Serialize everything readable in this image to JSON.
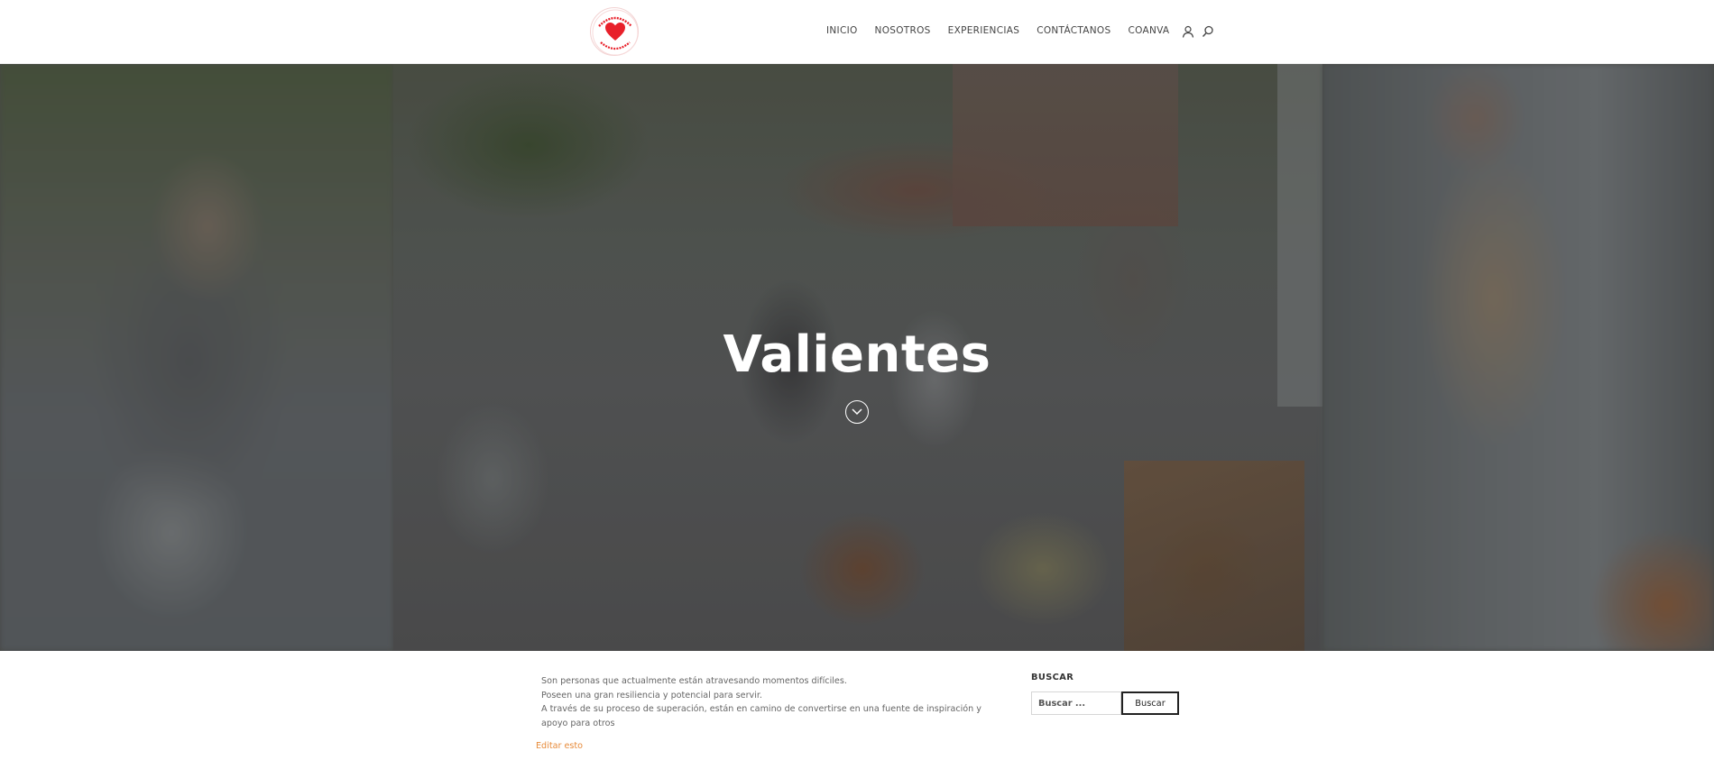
{
  "site": {
    "logo_alt": "Amanecer y Valientes Corporación"
  },
  "nav": {
    "items": [
      "INICIO",
      "NOSOTROS",
      "EXPERIENCIAS",
      "CONTÁCTANOS",
      "COANVA"
    ],
    "icons": [
      "user-icon",
      "search-icon"
    ]
  },
  "hero": {
    "title": "Valientes",
    "scroll_icon": "chevron-down-circle-icon"
  },
  "content": {
    "paragraphs": [
      "Son personas que actualmente están atravesando momentos difíciles.",
      "Poseen una gran resiliencia y potencial para servir.",
      "A través de su proceso de superación, están en camino de convertirse en una fuente de inspiración y apoyo para otros"
    ],
    "edit_link": "Editar esto"
  },
  "sidebar": {
    "search": {
      "title": "BUSCAR",
      "placeholder": "Buscar ...",
      "button_label": "Buscar"
    }
  },
  "colors": {
    "accent": "#e78b3a",
    "logo_heart": "#e8202a"
  }
}
